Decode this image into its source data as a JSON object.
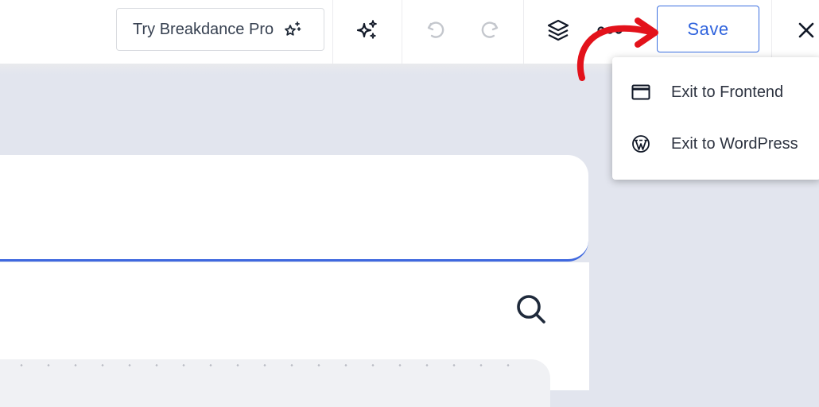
{
  "toolbar": {
    "try_pro_label": "Try Breakdance Pro",
    "save_label": "Save"
  },
  "menu": {
    "items": [
      {
        "label": "Exit to Frontend",
        "icon": "window-icon"
      },
      {
        "label": "Exit to WordPress",
        "icon": "wordpress-icon"
      }
    ]
  },
  "colors": {
    "accent": "#2f63dd",
    "annotation_arrow": "#e3121b",
    "canvas_bg": "#e2e5ee"
  }
}
